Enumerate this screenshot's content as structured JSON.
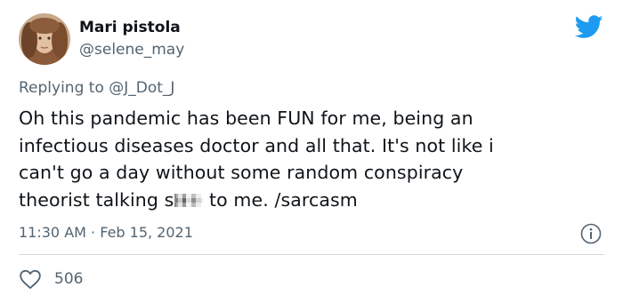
{
  "author": {
    "name": "Mari pistola",
    "handle": "@selene_may"
  },
  "reply": {
    "prefix": "Replying to",
    "to": "@J_Dot_J"
  },
  "tweet": {
    "lines": [
      "Oh this pandemic has been FUN for me, being an",
      "infectious diseases doctor and all that. It's not like i",
      "can't go a day without some random conspiracy"
    ],
    "line4_before": "theorist talking s",
    "line4_after": " to me. /sarcasm"
  },
  "meta": {
    "time": "11:30 AM",
    "separator": "·",
    "date": "Feb 15, 2021"
  },
  "actions": {
    "like_count": "506"
  },
  "icons": {
    "brand": "twitter-bird-icon",
    "info": "info-icon",
    "like": "heart-icon"
  },
  "colors": {
    "brand": "#1d9bf0",
    "text": "#0f1419",
    "secondary": "#536471",
    "divider": "#cfd9de"
  }
}
